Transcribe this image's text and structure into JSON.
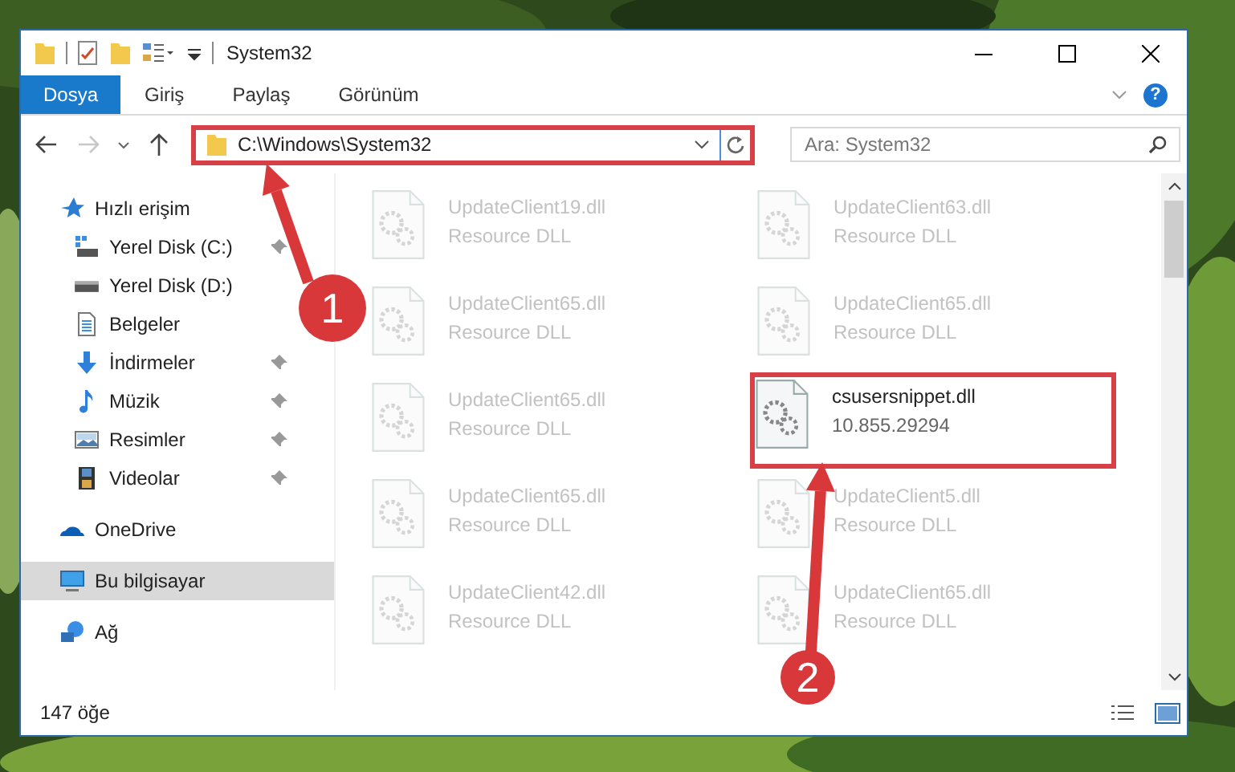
{
  "window": {
    "title": "System32"
  },
  "ribbon": {
    "tabs": [
      {
        "label": "Dosya",
        "selected": true
      },
      {
        "label": "Giriş",
        "selected": false
      },
      {
        "label": "Paylaş",
        "selected": false
      },
      {
        "label": "Görünüm",
        "selected": false
      }
    ],
    "help": "?"
  },
  "address": {
    "path": "C:\\Windows\\System32",
    "highlighted": true
  },
  "search": {
    "placeholder": "Ara: System32"
  },
  "sidebar": {
    "items": [
      {
        "label": "Hızlı erişim",
        "kind": "star",
        "selected": false,
        "children": [
          {
            "label": "Yerel Disk (C:)",
            "kind": "windows-drive",
            "pinned": true,
            "selected": false
          },
          {
            "label": "Yerel Disk (D:)",
            "kind": "drive",
            "pinned": false,
            "selected": false
          },
          {
            "label": "Belgeler",
            "kind": "documents",
            "pinned": false,
            "selected": false
          },
          {
            "label": "İndirmeler",
            "kind": "download",
            "pinned": true,
            "selected": false
          },
          {
            "label": "Müzik",
            "kind": "music",
            "pinned": true,
            "selected": false
          },
          {
            "label": "Resimler",
            "kind": "pictures",
            "pinned": true,
            "selected": false
          },
          {
            "label": "Videolar",
            "kind": "videos",
            "pinned": true,
            "selected": false
          }
        ]
      },
      {
        "label": "OneDrive",
        "kind": "cloud",
        "selected": false
      },
      {
        "label": "Bu bilgisayar",
        "kind": "computer",
        "selected": true
      },
      {
        "label": "Ağ",
        "kind": "network",
        "selected": false
      }
    ]
  },
  "files": [
    {
      "name": "UpdateClient19.dll",
      "detail": "Resource DLL",
      "highlighted": false
    },
    {
      "name": "UpdateClient63.dll",
      "detail": "Resource DLL",
      "highlighted": false
    },
    {
      "name": "UpdateClient65.dll",
      "detail": "Resource DLL",
      "highlighted": false
    },
    {
      "name": "UpdateClient65.dll",
      "detail": "Resource DLL",
      "highlighted": false
    },
    {
      "name": "UpdateClient65.dll",
      "detail": "Resource DLL",
      "highlighted": false
    },
    {
      "name": "csusersnippet.dll",
      "detail": "10.855.29294",
      "highlighted": true
    },
    {
      "name": "UpdateClient65.dll",
      "detail": "Resource DLL",
      "highlighted": false
    },
    {
      "name": "UpdateClient5.dll",
      "detail": "Resource DLL",
      "highlighted": false
    },
    {
      "name": "UpdateClient42.dll",
      "detail": "Resource DLL",
      "highlighted": false
    },
    {
      "name": "UpdateClient65.dll",
      "detail": "Resource DLL",
      "highlighted": false
    }
  ],
  "status_bar": {
    "count": "147 öğe"
  },
  "annotations": [
    {
      "number": "1"
    },
    {
      "number": "2"
    }
  ]
}
